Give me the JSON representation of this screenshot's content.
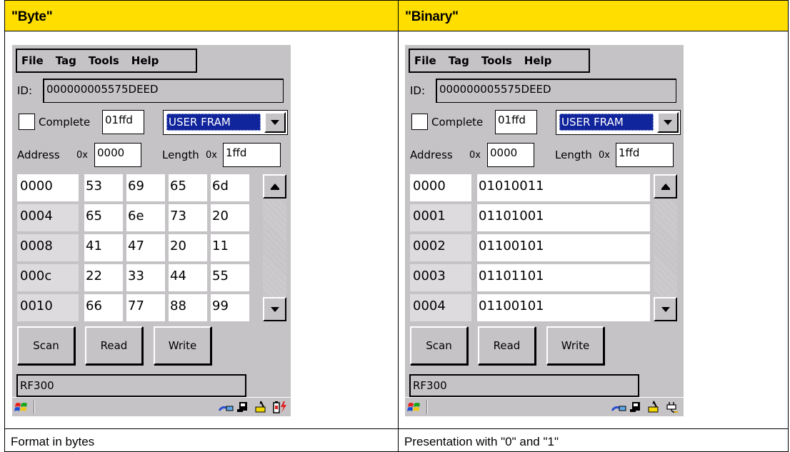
{
  "headers": {
    "left": "\"Byte\"",
    "right": "\"Binary\""
  },
  "captions": {
    "left": "Format in bytes",
    "right": "Presentation with \"0\" and \"1\""
  },
  "menu": [
    "File",
    "Tag",
    "Tools",
    "Help"
  ],
  "id_label": "ID:",
  "id_value": "000000005575DEED",
  "complete_label": "Complete",
  "complete_value": "01ffd",
  "memory_select": "USER FRAM",
  "address_label": "Address",
  "address_prefix": "0x",
  "address_value": "0000",
  "length_label": "Length",
  "length_prefix": "0x",
  "length_value": "1ffd",
  "byte_rows": [
    {
      "addr": "0000",
      "b": [
        "53",
        "69",
        "65",
        "6d"
      ]
    },
    {
      "addr": "0004",
      "b": [
        "65",
        "6e",
        "73",
        "20"
      ]
    },
    {
      "addr": "0008",
      "b": [
        "41",
        "47",
        "20",
        "11"
      ]
    },
    {
      "addr": "000c",
      "b": [
        "22",
        "33",
        "44",
        "55"
      ]
    },
    {
      "addr": "0010",
      "b": [
        "66",
        "77",
        "88",
        "99"
      ]
    }
  ],
  "binary_rows": [
    {
      "addr": "0000",
      "bits": "01010011"
    },
    {
      "addr": "0001",
      "bits": "01101001"
    },
    {
      "addr": "0002",
      "bits": "01100101"
    },
    {
      "addr": "0003",
      "bits": "01101101"
    },
    {
      "addr": "0004",
      "bits": "01100101"
    }
  ],
  "buttons": {
    "scan": "Scan",
    "read": "Read",
    "write": "Write"
  },
  "status": "RF300",
  "tray_icons": {
    "left": [
      "network-icon",
      "card-icon",
      "pen-icon",
      "battery-charging-icon"
    ],
    "right": [
      "network-icon",
      "card-icon",
      "pen-icon",
      "power-plug-icon"
    ]
  },
  "colors": {
    "header_bg": "#ffde00",
    "screen_bg": "#c6c3c6",
    "select_highlight": "#10249c"
  }
}
